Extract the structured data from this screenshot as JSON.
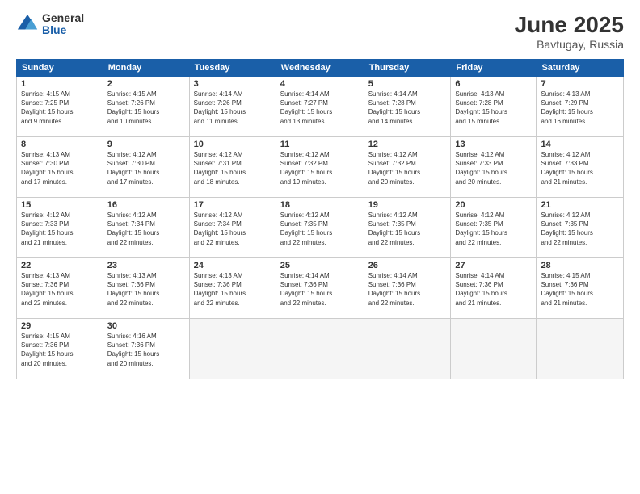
{
  "logo": {
    "general": "General",
    "blue": "Blue"
  },
  "title": {
    "month": "June 2025",
    "location": "Bavtugay, Russia"
  },
  "days_header": [
    "Sunday",
    "Monday",
    "Tuesday",
    "Wednesday",
    "Thursday",
    "Friday",
    "Saturday"
  ],
  "weeks": [
    [
      {
        "day": "1",
        "info": "Sunrise: 4:15 AM\nSunset: 7:25 PM\nDaylight: 15 hours\nand 9 minutes."
      },
      {
        "day": "2",
        "info": "Sunrise: 4:15 AM\nSunset: 7:26 PM\nDaylight: 15 hours\nand 10 minutes."
      },
      {
        "day": "3",
        "info": "Sunrise: 4:14 AM\nSunset: 7:26 PM\nDaylight: 15 hours\nand 11 minutes."
      },
      {
        "day": "4",
        "info": "Sunrise: 4:14 AM\nSunset: 7:27 PM\nDaylight: 15 hours\nand 13 minutes."
      },
      {
        "day": "5",
        "info": "Sunrise: 4:14 AM\nSunset: 7:28 PM\nDaylight: 15 hours\nand 14 minutes."
      },
      {
        "day": "6",
        "info": "Sunrise: 4:13 AM\nSunset: 7:28 PM\nDaylight: 15 hours\nand 15 minutes."
      },
      {
        "day": "7",
        "info": "Sunrise: 4:13 AM\nSunset: 7:29 PM\nDaylight: 15 hours\nand 16 minutes."
      }
    ],
    [
      {
        "day": "8",
        "info": "Sunrise: 4:13 AM\nSunset: 7:30 PM\nDaylight: 15 hours\nand 17 minutes."
      },
      {
        "day": "9",
        "info": "Sunrise: 4:12 AM\nSunset: 7:30 PM\nDaylight: 15 hours\nand 17 minutes."
      },
      {
        "day": "10",
        "info": "Sunrise: 4:12 AM\nSunset: 7:31 PM\nDaylight: 15 hours\nand 18 minutes."
      },
      {
        "day": "11",
        "info": "Sunrise: 4:12 AM\nSunset: 7:32 PM\nDaylight: 15 hours\nand 19 minutes."
      },
      {
        "day": "12",
        "info": "Sunrise: 4:12 AM\nSunset: 7:32 PM\nDaylight: 15 hours\nand 20 minutes."
      },
      {
        "day": "13",
        "info": "Sunrise: 4:12 AM\nSunset: 7:33 PM\nDaylight: 15 hours\nand 20 minutes."
      },
      {
        "day": "14",
        "info": "Sunrise: 4:12 AM\nSunset: 7:33 PM\nDaylight: 15 hours\nand 21 minutes."
      }
    ],
    [
      {
        "day": "15",
        "info": "Sunrise: 4:12 AM\nSunset: 7:33 PM\nDaylight: 15 hours\nand 21 minutes."
      },
      {
        "day": "16",
        "info": "Sunrise: 4:12 AM\nSunset: 7:34 PM\nDaylight: 15 hours\nand 22 minutes."
      },
      {
        "day": "17",
        "info": "Sunrise: 4:12 AM\nSunset: 7:34 PM\nDaylight: 15 hours\nand 22 minutes."
      },
      {
        "day": "18",
        "info": "Sunrise: 4:12 AM\nSunset: 7:35 PM\nDaylight: 15 hours\nand 22 minutes."
      },
      {
        "day": "19",
        "info": "Sunrise: 4:12 AM\nSunset: 7:35 PM\nDaylight: 15 hours\nand 22 minutes."
      },
      {
        "day": "20",
        "info": "Sunrise: 4:12 AM\nSunset: 7:35 PM\nDaylight: 15 hours\nand 22 minutes."
      },
      {
        "day": "21",
        "info": "Sunrise: 4:12 AM\nSunset: 7:35 PM\nDaylight: 15 hours\nand 22 minutes."
      }
    ],
    [
      {
        "day": "22",
        "info": "Sunrise: 4:13 AM\nSunset: 7:36 PM\nDaylight: 15 hours\nand 22 minutes."
      },
      {
        "day": "23",
        "info": "Sunrise: 4:13 AM\nSunset: 7:36 PM\nDaylight: 15 hours\nand 22 minutes."
      },
      {
        "day": "24",
        "info": "Sunrise: 4:13 AM\nSunset: 7:36 PM\nDaylight: 15 hours\nand 22 minutes."
      },
      {
        "day": "25",
        "info": "Sunrise: 4:14 AM\nSunset: 7:36 PM\nDaylight: 15 hours\nand 22 minutes."
      },
      {
        "day": "26",
        "info": "Sunrise: 4:14 AM\nSunset: 7:36 PM\nDaylight: 15 hours\nand 22 minutes."
      },
      {
        "day": "27",
        "info": "Sunrise: 4:14 AM\nSunset: 7:36 PM\nDaylight: 15 hours\nand 21 minutes."
      },
      {
        "day": "28",
        "info": "Sunrise: 4:15 AM\nSunset: 7:36 PM\nDaylight: 15 hours\nand 21 minutes."
      }
    ],
    [
      {
        "day": "29",
        "info": "Sunrise: 4:15 AM\nSunset: 7:36 PM\nDaylight: 15 hours\nand 20 minutes."
      },
      {
        "day": "30",
        "info": "Sunrise: 4:16 AM\nSunset: 7:36 PM\nDaylight: 15 hours\nand 20 minutes."
      },
      {
        "day": "",
        "info": ""
      },
      {
        "day": "",
        "info": ""
      },
      {
        "day": "",
        "info": ""
      },
      {
        "day": "",
        "info": ""
      },
      {
        "day": "",
        "info": ""
      }
    ]
  ]
}
